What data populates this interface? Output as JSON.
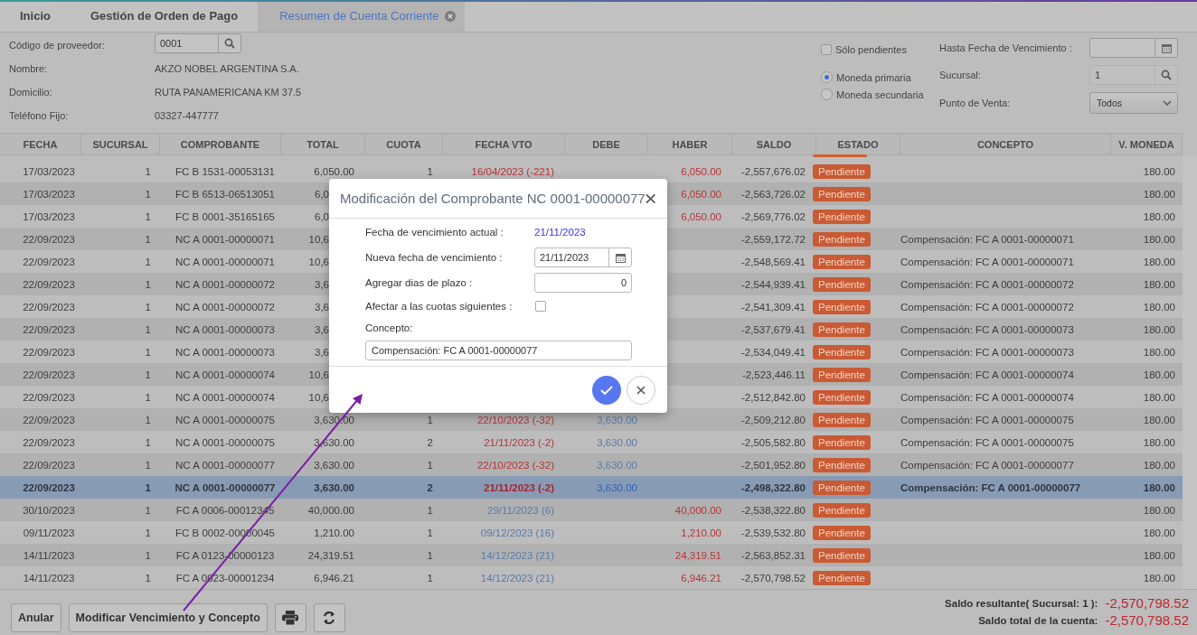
{
  "tabs": [
    {
      "label": "Inicio",
      "selected": false,
      "closable": false
    },
    {
      "label": "Gestión de Orden de Pago",
      "selected": false,
      "closable": false
    },
    {
      "label": "Resumen de Cuenta Corriente",
      "selected": true,
      "closable": true
    }
  ],
  "supplier": {
    "fields": [
      {
        "label": "Código de proveedor:",
        "value": "0001",
        "kind": "search"
      },
      {
        "label": "Nombre:",
        "value": "AKZO NOBEL ARGENTINA S.A.",
        "kind": "text"
      },
      {
        "label": "Domicilio:",
        "value": "RUTA PANAMERICANA KM 37.5",
        "kind": "text"
      },
      {
        "label": "Teléfono Fijo:",
        "value": "03327-447777",
        "kind": "text"
      }
    ]
  },
  "filters": {
    "only_pending": {
      "label": "Sólo pendientes",
      "checked": false
    },
    "currency": [
      {
        "label": "Moneda primaria",
        "selected": true
      },
      {
        "label": "Moneda secundaria",
        "selected": false
      }
    ],
    "fields": [
      {
        "label": "Hasta Fecha de Vencimiento :",
        "kind": "date",
        "disabled": false
      },
      {
        "label": "Sucursal:",
        "value": "1",
        "kind": "search",
        "disabled": true
      },
      {
        "label": "Punto de Venta:",
        "value": "Todos",
        "kind": "select",
        "disabled": false
      }
    ]
  },
  "table": {
    "columns": [
      {
        "label": "FECHA",
        "sorted": false
      },
      {
        "label": "SUCURSAL",
        "sorted": false
      },
      {
        "label": "COMPROBANTE",
        "sorted": false
      },
      {
        "label": "TOTAL",
        "sorted": false
      },
      {
        "label": "CUOTA",
        "sorted": false
      },
      {
        "label": "FECHA VTO",
        "sorted": false
      },
      {
        "label": "DEBE",
        "sorted": false
      },
      {
        "label": "HABER",
        "sorted": false
      },
      {
        "label": "SALDO",
        "sorted": false
      },
      {
        "label": "ESTADO",
        "sorted": true
      },
      {
        "label": "CONCEPTO",
        "sorted": false
      },
      {
        "label": "V. MONEDA",
        "sorted": false
      }
    ],
    "rows": [
      {
        "fecha": "17/03/2023",
        "sucursal": "1",
        "comprobante": "FC B 1531-00053131",
        "total": "6,050.00",
        "cuota": "1",
        "fecha_vto": "16/04/2023 (-221)",
        "overdue": true,
        "haber": "6,050.00",
        "saldo": "-2,557,676.02",
        "estado": "Pendiente",
        "v_moneda": "180.00",
        "selected": false
      },
      {
        "fecha": "17/03/2023",
        "sucursal": "1",
        "comprobante": "FC B 6513-06513051",
        "total": "6,0",
        "under_dialog": true,
        "haber": "6,050.00",
        "saldo": "-2,563,726.02",
        "estado": "Pendiente",
        "v_moneda": "180.00",
        "selected": false
      },
      {
        "fecha": "17/03/2023",
        "sucursal": "1",
        "comprobante": "FC B 0001-35165165",
        "total": "6,0",
        "under_dialog": true,
        "haber": "6,050.00",
        "saldo": "-2,569,776.02",
        "estado": "Pendiente",
        "v_moneda": "180.00",
        "selected": false
      },
      {
        "fecha": "22/09/2023",
        "sucursal": "1",
        "comprobante": "NC A 0001-00000071",
        "total": "10,6",
        "under_dialog": true,
        "saldo": "-2,559,172.72",
        "estado": "Pendiente",
        "concepto": "Compensación: FC A 0001-00000071",
        "v_moneda": "180.00",
        "selected": false
      },
      {
        "fecha": "22/09/2023",
        "sucursal": "1",
        "comprobante": "NC A 0001-00000071",
        "total": "10,6",
        "under_dialog": true,
        "saldo": "-2,548,569.41",
        "estado": "Pendiente",
        "concepto": "Compensación: FC A 0001-00000071",
        "v_moneda": "180.00",
        "selected": false
      },
      {
        "fecha": "22/09/2023",
        "sucursal": "1",
        "comprobante": "NC A 0001-00000072",
        "total": "3,6",
        "under_dialog": true,
        "saldo": "-2,544,939.41",
        "estado": "Pendiente",
        "concepto": "Compensación: FC A 0001-00000072",
        "v_moneda": "180.00",
        "selected": false
      },
      {
        "fecha": "22/09/2023",
        "sucursal": "1",
        "comprobante": "NC A 0001-00000072",
        "total": "3,6",
        "under_dialog": true,
        "saldo": "-2,541,309.41",
        "estado": "Pendiente",
        "concepto": "Compensación: FC A 0001-00000072",
        "v_moneda": "180.00",
        "selected": false
      },
      {
        "fecha": "22/09/2023",
        "sucursal": "1",
        "comprobante": "NC A 0001-00000073",
        "total": "3,6",
        "under_dialog": true,
        "saldo": "-2,537,679.41",
        "estado": "Pendiente",
        "concepto": "Compensación: FC A 0001-00000073",
        "v_moneda": "180.00",
        "selected": false
      },
      {
        "fecha": "22/09/2023",
        "sucursal": "1",
        "comprobante": "NC A 0001-00000073",
        "total": "3,6",
        "under_dialog": true,
        "saldo": "-2,534,049.41",
        "estado": "Pendiente",
        "concepto": "Compensación: FC A 0001-00000073",
        "v_moneda": "180.00",
        "selected": false
      },
      {
        "fecha": "22/09/2023",
        "sucursal": "1",
        "comprobante": "NC A 0001-00000074",
        "total": "10,6",
        "under_dialog": true,
        "saldo": "-2,523,446.11",
        "estado": "Pendiente",
        "concepto": "Compensación: FC A 0001-00000074",
        "v_moneda": "180.00",
        "selected": false
      },
      {
        "fecha": "22/09/2023",
        "sucursal": "1",
        "comprobante": "NC A 0001-00000074",
        "total": "10,6",
        "under_dialog": true,
        "saldo": "-2,512,842.80",
        "estado": "Pendiente",
        "concepto": "Compensación: FC A 0001-00000074",
        "v_moneda": "180.00",
        "selected": false
      },
      {
        "fecha": "22/09/2023",
        "sucursal": "1",
        "comprobante": "NC A 0001-00000075",
        "total": "3,630.00",
        "cuota": "1",
        "fecha_vto": "22/10/2023 (-32)",
        "overdue": true,
        "debe": "3,630.00",
        "saldo": "-2,509,212.80",
        "estado": "Pendiente",
        "concepto": "Compensación: FC A 0001-00000075",
        "v_moneda": "180.00",
        "selected": false
      },
      {
        "fecha": "22/09/2023",
        "sucursal": "1",
        "comprobante": "NC A 0001-00000075",
        "total": "3,630.00",
        "cuota": "2",
        "fecha_vto": "21/11/2023 (-2)",
        "overdue": true,
        "debe": "3,630.00",
        "saldo": "-2,505,582.80",
        "estado": "Pendiente",
        "concepto": "Compensación: FC A 0001-00000075",
        "v_moneda": "180.00",
        "selected": false
      },
      {
        "fecha": "22/09/2023",
        "sucursal": "1",
        "comprobante": "NC A 0001-00000077",
        "total": "3,630.00",
        "cuota": "1",
        "fecha_vto": "22/10/2023 (-32)",
        "overdue": true,
        "debe": "3,630.00",
        "saldo": "-2,501,952.80",
        "estado": "Pendiente",
        "concepto": "Compensación: FC A 0001-00000077",
        "v_moneda": "180.00",
        "selected": false
      },
      {
        "fecha": "22/09/2023",
        "sucursal": "1",
        "comprobante": "NC A 0001-00000077",
        "total": "3,630.00",
        "cuota": "2",
        "fecha_vto": "21/11/2023 (-2)",
        "overdue": true,
        "debe": "3,630.00",
        "saldo": "-2,498,322.80",
        "estado": "Pendiente",
        "concepto": "Compensación: FC A 0001-00000077",
        "v_moneda": "180.00",
        "selected": true
      },
      {
        "fecha": "30/10/2023",
        "sucursal": "1",
        "comprobante": "FC A 0006-00012345",
        "total": "40,000.00",
        "cuota": "1",
        "fecha_vto": "29/11/2023 (6)",
        "overdue": false,
        "haber": "40,000.00",
        "saldo": "-2,538,322.80",
        "estado": "Pendiente",
        "v_moneda": "180.00",
        "selected": false
      },
      {
        "fecha": "09/11/2023",
        "sucursal": "1",
        "comprobante": "FC B 0002-00000045",
        "total": "1,210.00",
        "cuota": "1",
        "fecha_vto": "09/12/2023 (16)",
        "overdue": false,
        "haber": "1,210.00",
        "saldo": "-2,539,532.80",
        "estado": "Pendiente",
        "v_moneda": "180.00",
        "selected": false
      },
      {
        "fecha": "14/11/2023",
        "sucursal": "1",
        "comprobante": "FC A 0123-00000123",
        "total": "24,319.51",
        "cuota": "1",
        "fecha_vto": "14/12/2023 (21)",
        "overdue": false,
        "haber": "24,319.51",
        "saldo": "-2,563,852.31",
        "estado": "Pendiente",
        "v_moneda": "180.00",
        "selected": false
      },
      {
        "fecha": "14/11/2023",
        "sucursal": "1",
        "comprobante": "FC A 0023-00001234",
        "total": "6,946.21",
        "cuota": "1",
        "fecha_vto": "14/12/2023 (21)",
        "overdue": false,
        "haber": "6,946.21",
        "saldo": "-2,570,798.52",
        "estado": "Pendiente",
        "v_moneda": "180.00",
        "selected": false
      }
    ]
  },
  "footer": {
    "buttons": [
      {
        "kind": "text",
        "label": "Anular"
      },
      {
        "kind": "text",
        "label": "Modificar Vencimiento y Concepto"
      },
      {
        "kind": "print"
      },
      {
        "kind": "refresh"
      }
    ],
    "totals": [
      {
        "label": "Saldo resultante( Sucursal: 1 ):",
        "value": "-2,570,798.52"
      },
      {
        "label": "Saldo total de la cuenta:",
        "value": "-2,570,798.52"
      }
    ]
  },
  "modal": {
    "title": "Modificación del Comprobante NC 0001-00000077",
    "fields": [
      {
        "kind": "readout",
        "label": "Fecha de vencimiento actual :",
        "value": "21/11/2023"
      },
      {
        "kind": "date",
        "label": "Nueva fecha de vencimiento :",
        "value": "21/11/2023"
      },
      {
        "kind": "number",
        "label": "Agregar dias de plazo :",
        "value": "0"
      },
      {
        "kind": "checkbox",
        "label": "Afectar a las cuotas siguientes :",
        "checked": false
      },
      {
        "kind": "wide",
        "label": "Concepto:",
        "value": "Compensación: FC A 0001-00000077"
      }
    ]
  }
}
